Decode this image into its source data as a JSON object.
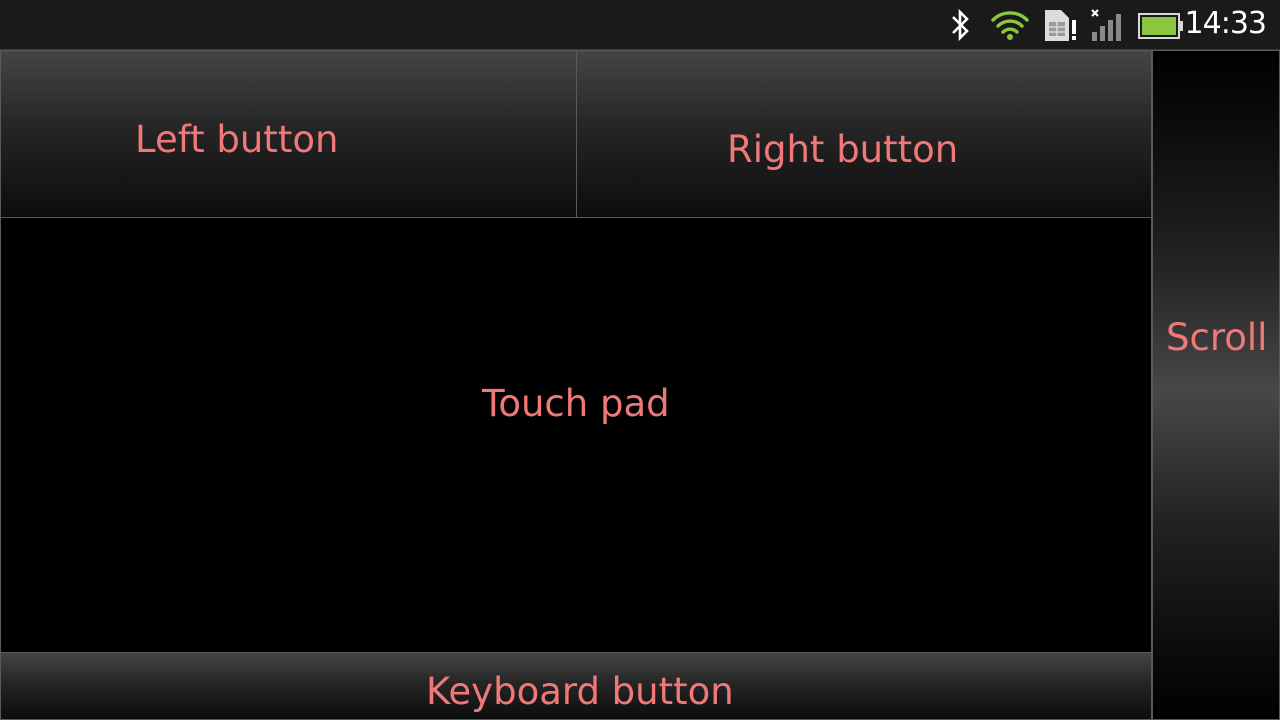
{
  "status_bar": {
    "time": "14:33",
    "icons": [
      "bluetooth-icon",
      "wifi-icon",
      "sim-alert-icon",
      "signal-off-icon",
      "battery-icon"
    ],
    "colors": {
      "wifi": "#8cc63f",
      "battery": "#8cc63f",
      "text": "#ffffff"
    }
  },
  "controls": {
    "left_button": "Left button",
    "right_button": "Right button",
    "touch_pad": "Touch pad",
    "scroll": "Scroll",
    "keyboard_button": "Keyboard button"
  },
  "theme": {
    "label_color": "#f07878",
    "border_color": "#5a5a5a",
    "background": "#000000"
  }
}
